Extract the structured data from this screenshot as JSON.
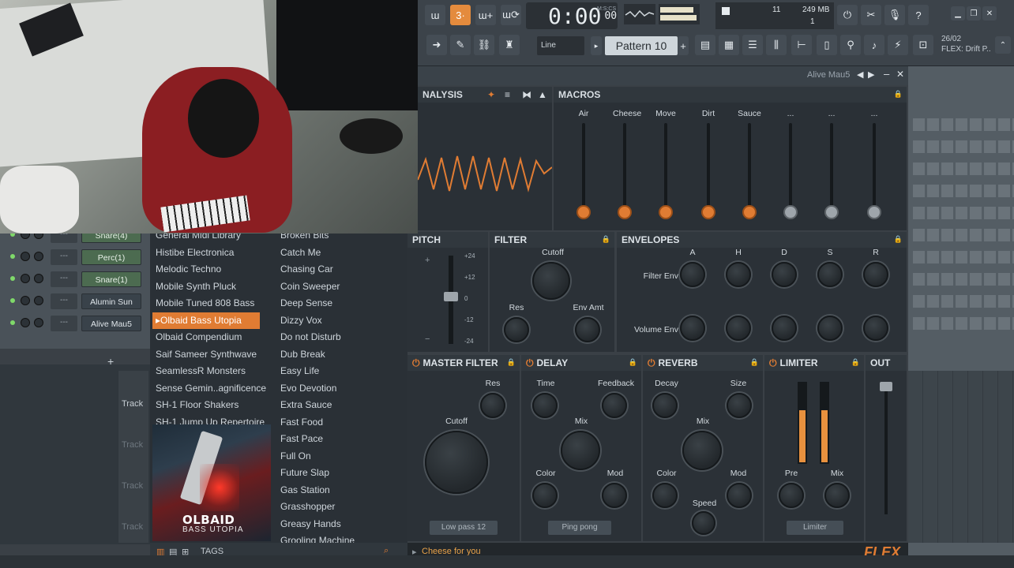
{
  "topbar": {
    "time": "0:00",
    "time_small": "00",
    "time_unit": "M:S:CS",
    "mem_top": "11",
    "mem_mb": "249 MB",
    "mem_bottom": "1",
    "line_mode": "Line",
    "pattern": "Pattern 10",
    "hint_date": "26/02",
    "hint_text": "FLEX: Drift P.."
  },
  "plugin": {
    "window_title": "Alive Mau5",
    "analysis_title": "NALYSIS",
    "macros_title": "MACROS",
    "macros": [
      "Air",
      "Cheese",
      "Move",
      "Dirt",
      "Sauce",
      "...",
      "...",
      "..."
    ],
    "macro_levels": [
      0,
      0,
      0,
      0,
      0,
      0,
      0,
      0
    ],
    "pitch_title": "PITCH",
    "pitch_ticks": [
      "+24",
      "+12",
      "0",
      "-12",
      "-24"
    ],
    "pitch_plus": "+",
    "pitch_minus": "−",
    "filter_title": "FILTER",
    "filter_cutoff": "Cutoff",
    "filter_res": "Res",
    "filter_envamt": "Env Amt",
    "envelopes_title": "ENVELOPES",
    "env_cols": [
      "A",
      "H",
      "D",
      "S",
      "R"
    ],
    "env_rows": [
      "Filter Env",
      "Volume Env"
    ],
    "master_filter_title": "MASTER FILTER",
    "mf_res": "Res",
    "mf_cutoff": "Cutoff",
    "mf_type": "Low pass 12",
    "delay_title": "DELAY",
    "delay_time": "Time",
    "delay_feedback": "Feedback",
    "delay_mix": "Mix",
    "delay_color": "Color",
    "delay_mod": "Mod",
    "delay_mode": "Ping pong",
    "reverb_title": "REVERB",
    "reverb_decay": "Decay",
    "reverb_size": "Size",
    "reverb_mix": "Mix",
    "reverb_color": "Color",
    "reverb_mod": "Mod",
    "reverb_speed": "Speed",
    "limiter_title": "LIMITER",
    "limiter_pre": "Pre",
    "limiter_mix": "Mix",
    "limiter_mode": "Limiter",
    "out_title": "OUT",
    "status_text": "Cheese for you",
    "logo": "FLEX"
  },
  "channels": [
    {
      "name": "Snare(4)",
      "green": true,
      "dots": "---"
    },
    {
      "name": "Perc(1)",
      "green": true,
      "dots": "---"
    },
    {
      "name": "Snare(1)",
      "green": true,
      "dots": "---"
    },
    {
      "name": "Alumin Sun",
      "green": false,
      "dots": "---"
    },
    {
      "name": "Alive Mau5",
      "green": false,
      "dots": "---"
    }
  ],
  "channel_add": "+",
  "tracks": [
    "Track",
    "Track",
    "Track",
    "Track"
  ],
  "browser": {
    "packs": [
      "General Midi Library",
      "Histibe Electronica",
      "Melodic Techno",
      "Mobile Synth Pluck",
      "Mobile Tuned 808 Bass",
      "Olbaid Bass Utopia",
      "Olbaid Compendium",
      "Saif Sameer Synthwave",
      "SeamlessR Monsters",
      "Sense Gemin..agnificence",
      "SH-1 Floor Shakers",
      "SH-1 Jump Up Repertoire"
    ],
    "selected_index": 5,
    "presets": [
      "Broken Bits",
      "Catch Me",
      "Chasing Car",
      "Coin Sweeper",
      "Deep Sense",
      "Dizzy Vox",
      "Do not Disturb",
      "Dub Break",
      "Easy Life",
      "Evo Devotion",
      "Extra Sauce",
      "Fast Food",
      "Fast Pace",
      "Full On",
      "Future Slap",
      "Gas Station",
      "Grasshopper",
      "Greasy Hands",
      "Grooling Machine"
    ],
    "album_title": "OLBAID",
    "album_subtitle": "BASS UTOPIA",
    "tags_label": "TAGS"
  }
}
